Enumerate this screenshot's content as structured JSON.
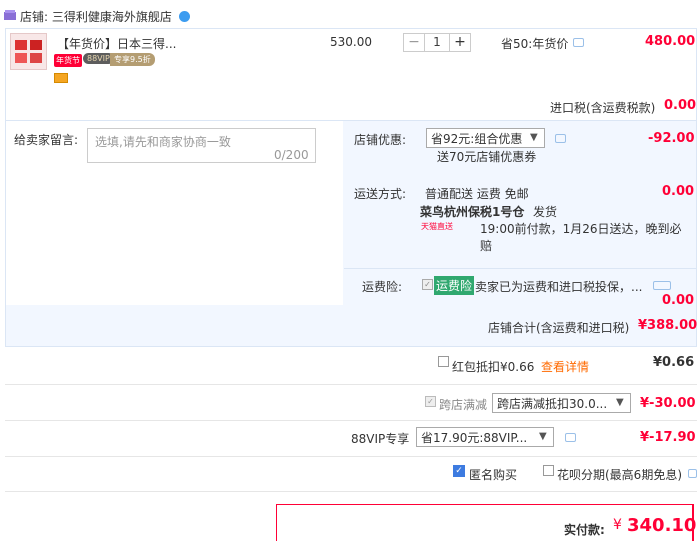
{
  "shop": {
    "label": "店铺: 三得利健康海外旗舰店"
  },
  "item": {
    "title": "【年货价】日本三得...",
    "badge_nianhuo": "年货节",
    "badge_vip": "88VIP",
    "badge_vip_discount": "专享9.5折",
    "unit_price": "530.00",
    "qty_minus": "−",
    "qty": "1",
    "qty_plus": "+",
    "promo": "省50:年货价",
    "subtotal": "480.00"
  },
  "tax": {
    "label": "进口税(含运费税款)",
    "value": "0.00"
  },
  "message": {
    "label": "给卖家留言:",
    "placeholder": "选填,请先和商家协商一致",
    "count": "0/200"
  },
  "shop_discount": {
    "label": "店铺优惠:",
    "selected": "省92元:组合优惠",
    "value": "-92.00",
    "desc": "送70元店铺优惠券"
  },
  "shipping": {
    "label": "运送方式:",
    "method": "普通配送 运费 免邮",
    "value": "0.00",
    "warehouse": "菜鸟杭州保税1号仓",
    "warehouse_send": "发货",
    "tmall_logo": "天猫直送",
    "time": "19:00前付款，1月26日送达，晚到必赔"
  },
  "insurance": {
    "label": "运费险:",
    "badge": "运费险",
    "text": "卖家已为运费和进口税投保，...",
    "value": "0.00"
  },
  "shop_total": {
    "label": "店铺合计(含运费和进口税)",
    "value": "¥388.00"
  },
  "hongbao": {
    "label": "红包抵扣¥0.66",
    "detail": "查看详情",
    "value": "¥0.66"
  },
  "cross_store": {
    "label": "跨店满减",
    "selected": "跨店满减抵扣30.0...",
    "value": "¥-30.00"
  },
  "vip": {
    "label": "88VIP专享",
    "selected": "省17.90元:88VIP...",
    "value": "¥-17.90"
  },
  "options": {
    "anonymous": "匿名购买",
    "huabei": "花呗分期(最高6期免息)"
  },
  "payment": {
    "label": "实付款:",
    "yen": "¥",
    "value": "340.10"
  },
  "colors": {
    "accent": "#ff0036",
    "panel": "#f2f7ff",
    "insure": "#30a86f"
  }
}
